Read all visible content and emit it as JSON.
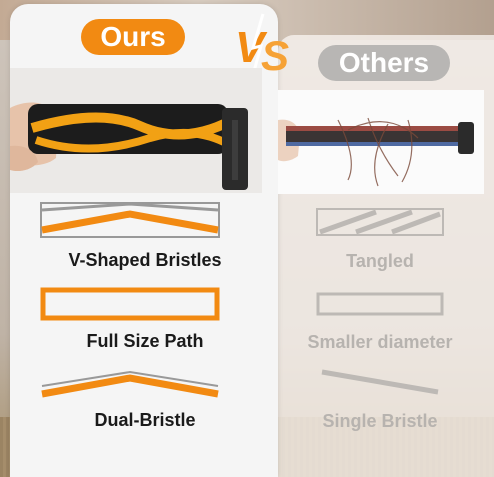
{
  "header": {
    "ours_label": "Ours",
    "vs_label": "VS",
    "others_label": "Others"
  },
  "ours": {
    "features": [
      {
        "label": "V-Shaped Bristles",
        "icon": "v-shaped-bristle-icon"
      },
      {
        "label": "Full Size Path",
        "icon": "full-size-path-icon"
      },
      {
        "label": "Dual-Bristle",
        "icon": "dual-bristle-icon"
      }
    ]
  },
  "others": {
    "features": [
      {
        "label": "Tangled",
        "icon": "tangled-bristle-icon"
      },
      {
        "label": "Smaller diameter",
        "icon": "smaller-path-icon"
      },
      {
        "label": "Single Bristle",
        "icon": "single-bristle-icon"
      }
    ]
  },
  "colors": {
    "accent": "#f28a12",
    "muted": "#b8b6b4",
    "text": "#1a1a1a",
    "muted_text": "#b7b3af"
  }
}
